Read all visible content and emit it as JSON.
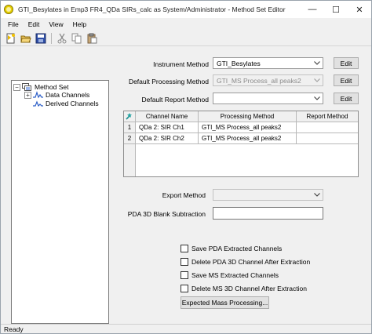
{
  "window": {
    "title": "GTI_Besylates in Emp3 FR4_QDa SIRs_calc as System/Administrator - Method Set Editor",
    "minimize_glyph": "—",
    "maximize_glyph": "☐",
    "close_glyph": "✕"
  },
  "menu": {
    "file": "File",
    "edit": "Edit",
    "view": "View",
    "help": "Help"
  },
  "toolbar": {
    "icons": [
      "new-icon",
      "open-icon",
      "save-icon",
      "cut-icon",
      "copy-icon",
      "paste-icon"
    ]
  },
  "tree": {
    "root": "Method Set",
    "data_channels": "Data Channels",
    "derived_channels": "Derived Channels",
    "expand_glyph": "−",
    "collapsed_glyph": "+"
  },
  "form": {
    "instrument_label": "Instrument Method",
    "instrument_value": "GTI_Besylates",
    "processing_label": "Default Processing Method",
    "processing_value": "GTI_MS Process_all peaks2",
    "report_label": "Default Report Method",
    "report_value": "",
    "edit_label": "Edit",
    "export_label": "Export Method",
    "export_value": "",
    "pda_label": "PDA 3D Blank Subtraction",
    "pda_value": ""
  },
  "grid": {
    "headers": [
      "Channel Name",
      "Processing Method",
      "Report Method"
    ],
    "rows": [
      {
        "num": "1",
        "channel": "QDa 2: SIR Ch1",
        "processing": "GTI_MS Process_all peaks2",
        "report": ""
      },
      {
        "num": "2",
        "channel": "QDa 2: SIR Ch2",
        "processing": "GTI_MS Process_all peaks2",
        "report": ""
      }
    ]
  },
  "options": {
    "save_pda": "Save PDA Extracted Channels",
    "delete_pda": "Delete PDA 3D Channel After Extraction",
    "save_ms": "Save MS Extracted Channels",
    "delete_ms": "Delete MS 3D Channel After Extraction",
    "expected_mass_button": "Expected Mass Processing..."
  },
  "status": {
    "text": "Ready"
  }
}
